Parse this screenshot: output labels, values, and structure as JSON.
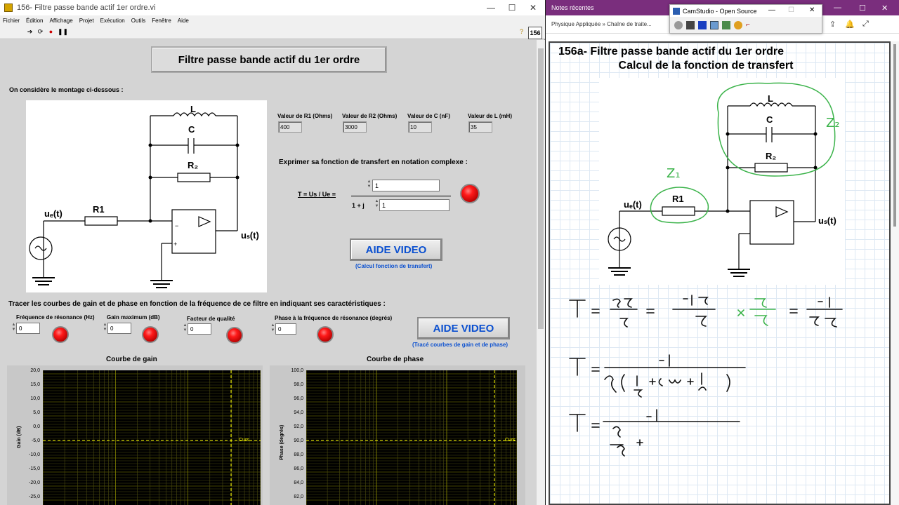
{
  "labview": {
    "window_title": "156- Filtre passe bande actif 1er ordre.vi",
    "menu": [
      "Fichier",
      "Édition",
      "Affichage",
      "Projet",
      "Exécution",
      "Outils",
      "Fenêtre",
      "Aide"
    ],
    "vi_icon_text": "156",
    "panel_title": "Filtre passe bande actif du 1er ordre",
    "montage_label": "On considère le montage ci-dessous :",
    "circuit_labels": {
      "L": "L",
      "C": "C",
      "R2": "R₂",
      "R1": "R1",
      "ue": "uₑ(t)",
      "us": "uₛ(t)"
    },
    "params": [
      {
        "label": "Valeur de R1 (Ohms)",
        "value": "400"
      },
      {
        "label": "Valeur de R2 (Ohms)",
        "value": "3000"
      },
      {
        "label": "Valeur de C (nF)",
        "value": "10"
      },
      {
        "label": "Valeur de L (mH)",
        "value": "35"
      }
    ],
    "express_label": "Exprimer sa fonction de transfert en notation complexe :",
    "formula_label": "T = Us / Ue =",
    "denominator_prefix": "1 + j",
    "numerator_value": "1",
    "denominator_value": "1",
    "aide_video_1": "AIDE VIDEO",
    "aide_video_1_sub": "(Calcul fonction de transfert)",
    "trace_label": "Tracer les courbes de gain et de phase en fonction de la fréquence de ce filtre en indiquant ses caractéristiques :",
    "measures": [
      {
        "label": "Fréquence de résonance (Hz)",
        "value": "0"
      },
      {
        "label": "Gain maximum (dB)",
        "value": "0"
      },
      {
        "label": "Facteur de qualité",
        "value": "0"
      },
      {
        "label": "Phase à la fréquence de résonance (degrés)",
        "value": "0"
      }
    ],
    "aide_video_2": "AIDE VIDEO",
    "aide_video_2_sub": "(Tracé courbes de gain et de phase)",
    "gain_graph": {
      "title": "Courbe de gain",
      "ylabel": "Gain (dB)",
      "cursor": "Curs",
      "ticks": [
        "20,0",
        "15,0",
        "10,0",
        "5,0",
        "0,0",
        "-5,0",
        "-10,0",
        "-15,0",
        "-20,0",
        "-25,0"
      ]
    },
    "phase_graph": {
      "title": "Courbe de phase",
      "ylabel": "Phase (degrés)",
      "cursor": "Curs",
      "ticks": [
        "100,0",
        "98,0",
        "96,0",
        "94,0",
        "92,0",
        "90,0",
        "88,0",
        "86,0",
        "84,0",
        "82,0"
      ]
    }
  },
  "onenote": {
    "window_title": "Notes récentes",
    "breadcrumb": "Physique Appliquée » Chaîne de traite...",
    "title_line1": "156a- Filtre passe bande actif du 1er ordre",
    "title_line2": "Calcul de la fonction de transfert",
    "circuit_labels": {
      "L": "L",
      "C": "C",
      "R2": "R₂",
      "R1": "R1",
      "ue": "uₑ(t)",
      "us": "uₛ(t)",
      "Z1": "Z₁",
      "Z2": "Z₂"
    }
  },
  "camstudio": {
    "title": "CamStudio - Open Source"
  },
  "colors": {
    "lv_bg": "#d4d4d4",
    "onenote_purple": "#7a2e7d",
    "led_red": "#ff1a1a",
    "button_blue": "#0b50d0",
    "grid_yellow": "#c8c800",
    "handwriting_green": "#3bb34a"
  }
}
